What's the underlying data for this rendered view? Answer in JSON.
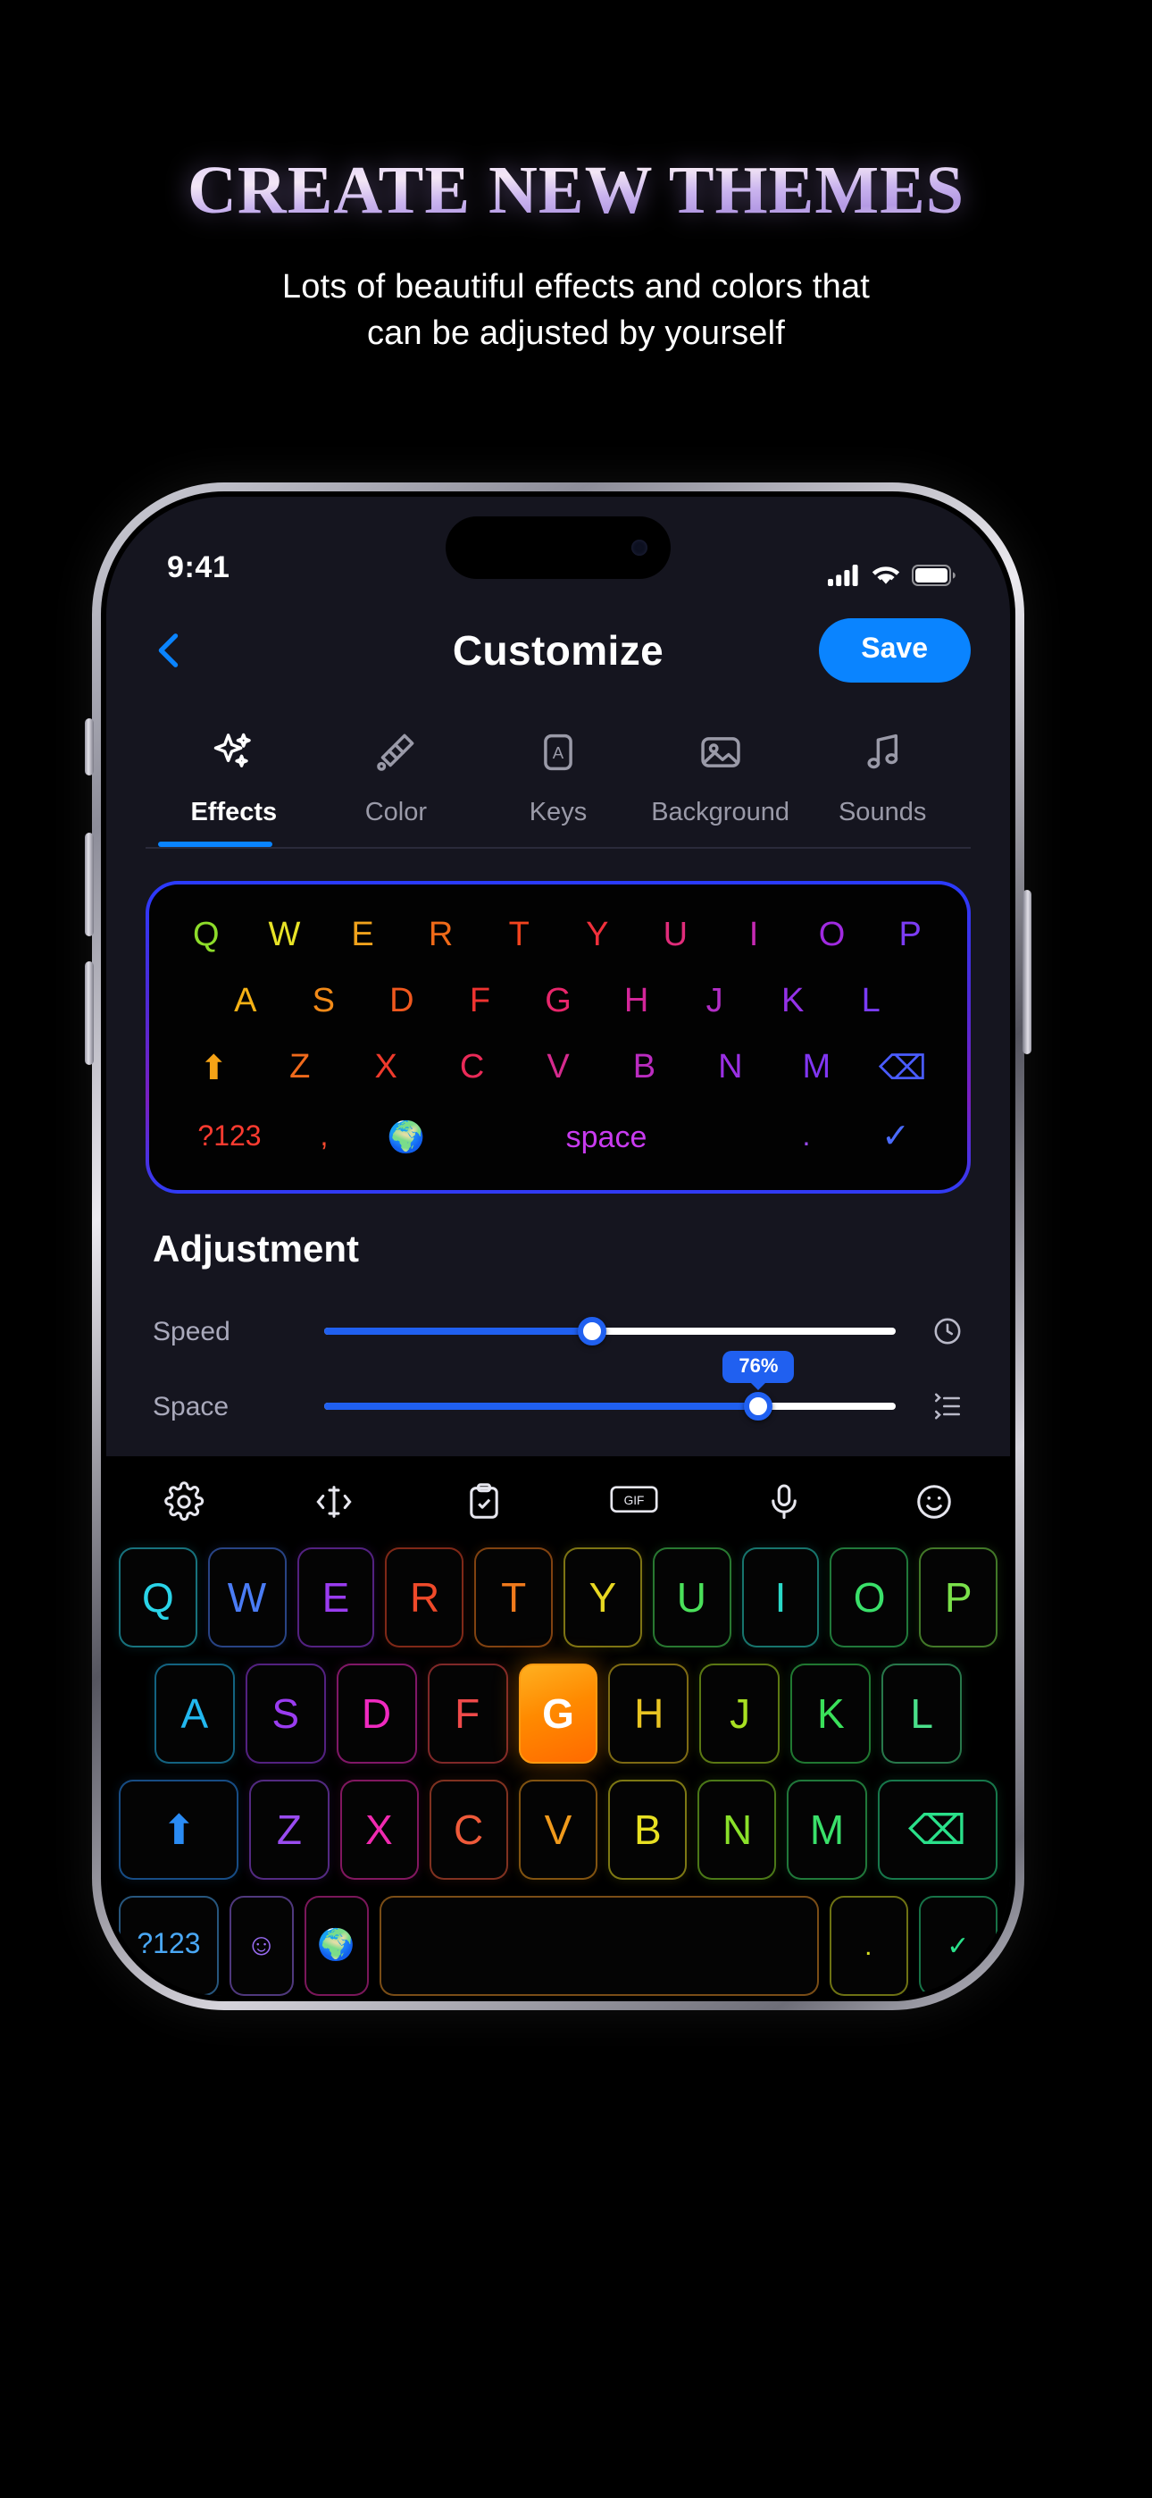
{
  "promo": {
    "title": "CREATE NEW THEMES",
    "subtitle_line1": "Lots of beautiful effects and colors that",
    "subtitle_line2": "can be adjusted by yourself",
    "title_gradient_from": "#e8d9f7",
    "title_gradient_to": "#b49ae4"
  },
  "statusbar": {
    "time": "9:41",
    "signal_icon": "cellular-signal-icon",
    "wifi_icon": "wifi-icon",
    "battery_icon": "battery-icon"
  },
  "navbar": {
    "back_icon": "back-chevron-icon",
    "title": "Customize",
    "save_label": "Save",
    "accent": "#0a84ff"
  },
  "tabs": {
    "active_index": 0,
    "items": [
      {
        "label": "Effects",
        "icon": "sparkles-icon"
      },
      {
        "label": "Color",
        "icon": "paint-brush-icon"
      },
      {
        "label": "Keys",
        "icon": "key-letter-icon"
      },
      {
        "label": "Background",
        "icon": "image-icon"
      },
      {
        "label": "Sounds",
        "icon": "music-note-icon"
      }
    ]
  },
  "preview_keyboard": {
    "border_gradient": [
      "#2a3bff",
      "#7a1fc0"
    ],
    "row1": [
      {
        "key": "Q",
        "color": "#8ddc2a"
      },
      {
        "key": "W",
        "color": "#e8e327"
      },
      {
        "key": "E",
        "color": "#f0a21c"
      },
      {
        "key": "R",
        "color": "#f06a18"
      },
      {
        "key": "T",
        "color": "#f2441f"
      },
      {
        "key": "Y",
        "color": "#f0303c"
      },
      {
        "key": "U",
        "color": "#e02c7a"
      },
      {
        "key": "I",
        "color": "#c62ab4"
      },
      {
        "key": "O",
        "color": "#a02ae0"
      },
      {
        "key": "P",
        "color": "#7c3cf5"
      }
    ],
    "row2": [
      {
        "key": "A",
        "color": "#f5b215"
      },
      {
        "key": "S",
        "color": "#f28a18"
      },
      {
        "key": "D",
        "color": "#f0581e"
      },
      {
        "key": "F",
        "color": "#ef3330"
      },
      {
        "key": "G",
        "color": "#e8266b"
      },
      {
        "key": "H",
        "color": "#d32699"
      },
      {
        "key": "J",
        "color": "#b22ec6"
      },
      {
        "key": "K",
        "color": "#9432e8"
      },
      {
        "key": "L",
        "color": "#7a3cf5"
      }
    ],
    "row3": [
      {
        "key": "shift-icon",
        "color": "#f5a316"
      },
      {
        "key": "Z",
        "color": "#f06a1c"
      },
      {
        "key": "X",
        "color": "#ef3a2c"
      },
      {
        "key": "C",
        "color": "#ea2a58"
      },
      {
        "key": "V",
        "color": "#d52a8e"
      },
      {
        "key": "B",
        "color": "#bb2cc0"
      },
      {
        "key": "N",
        "color": "#9b30e4"
      },
      {
        "key": "M",
        "color": "#8136f2"
      },
      {
        "key": "backspace-icon",
        "color": "#4a5cff"
      }
    ],
    "row4": {
      "numeric": "?123",
      "comma": ",",
      "globe_icon": "globe-icon",
      "space": "space",
      "period": ".",
      "enter_icon": "checkmark-icon"
    }
  },
  "adjustment": {
    "title": "Adjustment",
    "sliders": [
      {
        "label": "Speed",
        "percent": 47,
        "value_label": null,
        "icon": "clock-icon"
      },
      {
        "label": "Space",
        "percent": 76,
        "value_label": "76%",
        "icon": "spacing-icon"
      }
    ],
    "accent": "#2060f0"
  },
  "keyboard": {
    "toolbar": [
      {
        "icon": "gear-icon"
      },
      {
        "icon": "cursor-move-icon"
      },
      {
        "icon": "clipboard-icon"
      },
      {
        "icon": "gif-icon"
      },
      {
        "icon": "microphone-icon"
      },
      {
        "icon": "emoji-smiley-icon"
      }
    ],
    "row1": [
      {
        "key": "Q",
        "color": "#2ad4e8"
      },
      {
        "key": "W",
        "color": "#4a7cf5"
      },
      {
        "key": "E",
        "color": "#9a3cf0"
      },
      {
        "key": "R",
        "color": "#ef4a2a"
      },
      {
        "key": "T",
        "color": "#f07a1c"
      },
      {
        "key": "Y",
        "color": "#e8d822"
      },
      {
        "key": "U",
        "color": "#4ae05a"
      },
      {
        "key": "I",
        "color": "#2ad8c8"
      },
      {
        "key": "O",
        "color": "#3ae06a"
      },
      {
        "key": "P",
        "color": "#7ae04a"
      }
    ],
    "row2": [
      {
        "key": "A",
        "color": "#22b8f0"
      },
      {
        "key": "S",
        "color": "#9a3cf0"
      },
      {
        "key": "D",
        "color": "#f02ac0"
      },
      {
        "key": "F",
        "color": "#ef4a4a"
      },
      {
        "key": "G",
        "color": "#ffffff",
        "highlighted": true
      },
      {
        "key": "H",
        "color": "#e8c422"
      },
      {
        "key": "J",
        "color": "#a8e022"
      },
      {
        "key": "K",
        "color": "#3ae05a"
      },
      {
        "key": "L",
        "color": "#4ae08a"
      }
    ],
    "row3": [
      {
        "key": "shift-icon",
        "color": "#2a8cf5"
      },
      {
        "key": "Z",
        "color": "#9a4cf0"
      },
      {
        "key": "X",
        "color": "#f02ab0"
      },
      {
        "key": "C",
        "color": "#ef5a3a"
      },
      {
        "key": "V",
        "color": "#f09a1c"
      },
      {
        "key": "B",
        "color": "#e8e022"
      },
      {
        "key": "N",
        "color": "#8ae02a"
      },
      {
        "key": "M",
        "color": "#3ae06a"
      },
      {
        "key": "backspace-icon",
        "color": "#2ae08a"
      }
    ],
    "row4": {
      "numeric": "?123",
      "emoji_icon": "emoji-smiley-icon",
      "globe_icon": "globe-icon",
      "space": "",
      "period": ".",
      "enter_icon": "checkmark-icon"
    }
  }
}
